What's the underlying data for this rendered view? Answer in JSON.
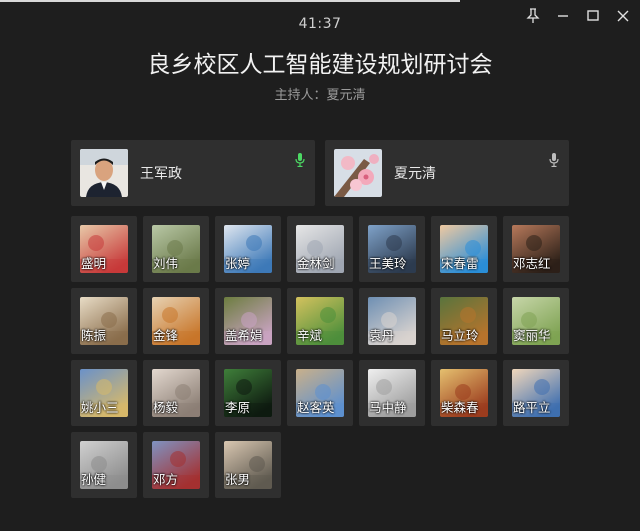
{
  "window": {
    "timer": "41:37",
    "controls": [
      "pin-icon",
      "minimize-icon",
      "maximize-icon",
      "close-icon"
    ]
  },
  "meeting": {
    "title": "良乡校区人工智能建设规划研讨会",
    "host_label": "主持人：",
    "host_name": "夏元清"
  },
  "speakers": [
    {
      "name": "王军政",
      "mic": "active",
      "mic_color": "#4cd964"
    },
    {
      "name": "夏元清",
      "mic": "idle",
      "mic_color": "#bdbdbd"
    }
  ],
  "participants": [
    {
      "name": "盛明",
      "colors": [
        "#c73a3a",
        "#e8c9a8"
      ]
    },
    {
      "name": "刘伟",
      "colors": [
        "#6b7a4a",
        "#b9c8a6"
      ]
    },
    {
      "name": "张婷",
      "colors": [
        "#3d79b8",
        "#e0e6ef"
      ]
    },
    {
      "name": "金林剑",
      "colors": [
        "#9fa6b2",
        "#e6e6e6"
      ]
    },
    {
      "name": "王美玲",
      "colors": [
        "#2d3b4f",
        "#7fa2c9"
      ]
    },
    {
      "name": "宋春雷",
      "colors": [
        "#2b8ed8",
        "#f0c9a0"
      ]
    },
    {
      "name": "邓志红",
      "colors": [
        "#2c2018",
        "#b7795b"
      ]
    },
    {
      "name": "陈振",
      "colors": [
        "#8a6d4b",
        "#e8dcc6"
      ]
    },
    {
      "name": "金锋",
      "colors": [
        "#c8762a",
        "#e7d2b3"
      ]
    },
    {
      "name": "盖希娟",
      "colors": [
        "#c9a3c2",
        "#6c7d3f"
      ]
    },
    {
      "name": "辛斌",
      "colors": [
        "#4d8f3b",
        "#d4c25e"
      ]
    },
    {
      "name": "袁丹",
      "colors": [
        "#d9d3cf",
        "#6e8fb3"
      ]
    },
    {
      "name": "马立玲",
      "colors": [
        "#b7742c",
        "#59743d"
      ]
    },
    {
      "name": "窦丽华",
      "colors": [
        "#7fa353",
        "#c7d6a9"
      ]
    },
    {
      "name": "姚小三",
      "colors": [
        "#d7b96a",
        "#6a91c9"
      ]
    },
    {
      "name": "杨毅",
      "colors": [
        "#8c7f75",
        "#e3d8cf"
      ]
    },
    {
      "name": "李原",
      "colors": [
        "#0e1a10",
        "#3f7f3a"
      ]
    },
    {
      "name": "赵客英",
      "colors": [
        "#5d90cf",
        "#c9b08a"
      ]
    },
    {
      "name": "马中静",
      "colors": [
        "#9e9e9e",
        "#efefef"
      ]
    },
    {
      "name": "柴森春",
      "colors": [
        "#9b3c1e",
        "#e5c06f"
      ]
    },
    {
      "name": "路平立",
      "colors": [
        "#3f6fb0",
        "#f1d7bb"
      ]
    },
    {
      "name": "孙健",
      "colors": [
        "#8d8d8d",
        "#d0d0d0"
      ]
    },
    {
      "name": "邓方",
      "colors": [
        "#a43030",
        "#7f93c2"
      ]
    },
    {
      "name": "张男",
      "colors": [
        "#5f5a50",
        "#d9c7b1"
      ]
    }
  ]
}
